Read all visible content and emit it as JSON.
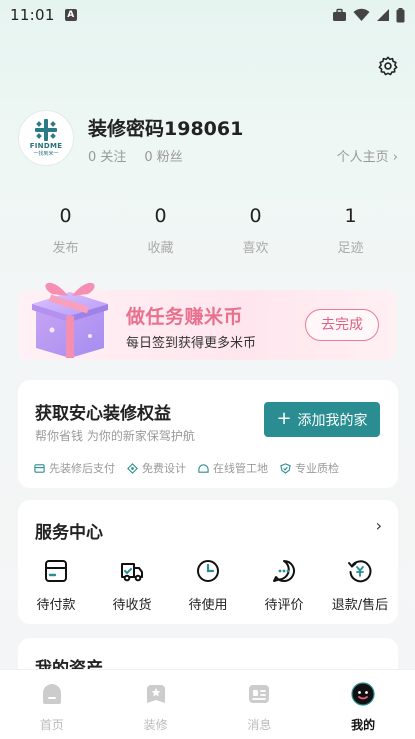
{
  "status_bar": {
    "time": "11:01",
    "a_icon": "A"
  },
  "profile": {
    "username": "装修密码198061",
    "follow": "0 关注",
    "fans": "0 粉丝",
    "homepage_link": "个人主页 ›",
    "avatar_brand": "FINDME",
    "avatar_sub": "一找到米一"
  },
  "stats": [
    {
      "num": "0",
      "label": "发布"
    },
    {
      "num": "0",
      "label": "收藏"
    },
    {
      "num": "0",
      "label": "喜欢"
    },
    {
      "num": "1",
      "label": "足迹"
    }
  ],
  "banner": {
    "title": "做任务赚米币",
    "subtitle": "每日签到获得更多米币",
    "button": "去完成"
  },
  "benefit": {
    "title": "获取安心装修权益",
    "subtitle": "帮你省钱 为你的新家保驾护航",
    "add_button": "添加我的家",
    "features": [
      "先装修后支付",
      "免费设计",
      "在线管工地",
      "专业质检"
    ]
  },
  "service": {
    "title": "服务中心",
    "arrow": "›",
    "items": [
      {
        "label": "待付款",
        "icon": "wallet-icon"
      },
      {
        "label": "待收货",
        "icon": "truck-icon"
      },
      {
        "label": "待使用",
        "icon": "clock-icon"
      },
      {
        "label": "待评价",
        "icon": "chat-icon"
      },
      {
        "label": "退款/售后",
        "icon": "refund-icon"
      }
    ]
  },
  "assets": {
    "title": "我的资产"
  },
  "tabbar": [
    {
      "label": "首页",
      "icon": "home-icon",
      "active": false
    },
    {
      "label": "装修",
      "icon": "decor-icon",
      "active": false
    },
    {
      "label": "消息",
      "icon": "message-icon",
      "active": false
    },
    {
      "label": "我的",
      "icon": "mine-icon",
      "active": true
    }
  ],
  "colors": {
    "accent": "#2a8d92",
    "banner_pink": "#e8718f"
  }
}
